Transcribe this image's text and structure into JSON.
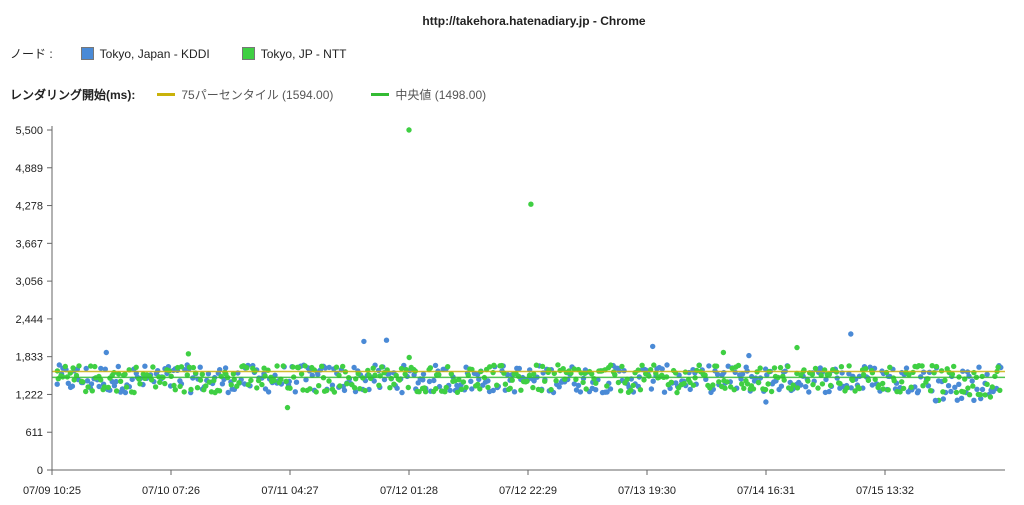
{
  "window_title": "http://takehora.hatenadiary.jp - Chrome",
  "nodes_label": "ノード :",
  "nodes": [
    {
      "name": "Tokyo, Japan - KDDI",
      "color": "#4a8ad6"
    },
    {
      "name": "Tokyo, JP - NTT",
      "color": "#3fcf43"
    }
  ],
  "metric_label": "レンダリング開始(ms):",
  "reference_lines": [
    {
      "label": "75パーセンタイル (1594.00)",
      "value": 1594,
      "color": "#c9b20a"
    },
    {
      "label": "中央値 (1498.00)",
      "value": 1498,
      "color": "#33bb33"
    }
  ],
  "chart_data": {
    "type": "scatter",
    "ylim": [
      0,
      5500
    ],
    "y_ticks": [
      "0",
      "611",
      "1,222",
      "1,833",
      "2,444",
      "3,056",
      "3,667",
      "4,278",
      "4,889",
      "5,500"
    ],
    "x_ticks": [
      "07/09 10:25",
      "07/10 07:26",
      "07/11 04:27",
      "07/12 01:28",
      "07/12 22:29",
      "07/13 19:30",
      "07/14 16:31",
      "07/15 13:32"
    ],
    "typical_range": [
      1250,
      1700
    ],
    "series": [
      {
        "name": "Tokyo, Japan - KDDI",
        "color": "#4a8ad6",
        "outliers": [
          {
            "x": "07/09 20:00",
            "y": 1900
          },
          {
            "x": "07/11 17:30",
            "y": 2080
          },
          {
            "x": "07/11 21:30",
            "y": 2100
          },
          {
            "x": "07/13 20:30",
            "y": 2000
          },
          {
            "x": "07/14 13:30",
            "y": 1850
          },
          {
            "x": "07/15 07:30",
            "y": 2200
          },
          {
            "x": "07/14 16:30",
            "y": 1100
          },
          {
            "x": "07/15 22:30",
            "y": 1120
          }
        ]
      },
      {
        "name": "Tokyo, JP - NTT",
        "color": "#3fcf43",
        "outliers": [
          {
            "x": "07/12 01:28",
            "y": 5500
          },
          {
            "x": "07/12 23:00",
            "y": 4300
          },
          {
            "x": "07/11 04:00",
            "y": 1010
          },
          {
            "x": "07/12 01:30",
            "y": 1820
          },
          {
            "x": "07/14 22:00",
            "y": 1980
          },
          {
            "x": "07/14 09:00",
            "y": 1900
          },
          {
            "x": "07/10 10:30",
            "y": 1880
          }
        ]
      }
    ]
  }
}
